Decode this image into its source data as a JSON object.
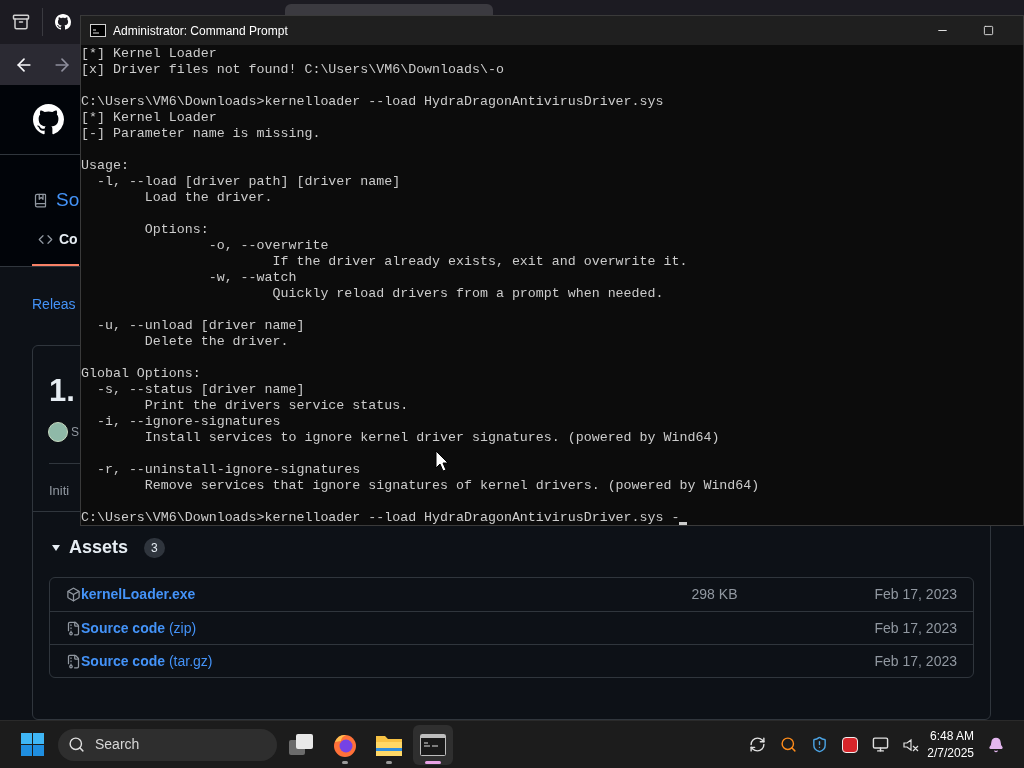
{
  "browser": {
    "repo_name": "So",
    "code_tab": {
      "label": "Co",
      "selected": true
    },
    "releases_link": "Releas",
    "release": {
      "version": "1.",
      "author": "S",
      "note": "Initi",
      "assets": {
        "title": "Assets",
        "count": "3",
        "expanded": true,
        "rows": [
          {
            "kind": "package",
            "name": "kernelLoader.exe",
            "size": "298 KB",
            "date": "Feb 17, 2023"
          },
          {
            "kind": "archive",
            "name": "Source code",
            "suffix": "(zip)",
            "date": "Feb 17, 2023"
          },
          {
            "kind": "archive",
            "name": "Source code",
            "suffix": "(tar.gz)",
            "date": "Feb 17, 2023"
          }
        ]
      }
    }
  },
  "terminal": {
    "title": "Administrator: Command Prompt",
    "blocks": [
      [
        "[*] Kernel Loader",
        "[x] Driver files not found! C:\\Users\\VM6\\Downloads\\-o"
      ],
      [
        "C:\\Users\\VM6\\Downloads>kernelloader --load HydraDragonAntivirusDriver.sys",
        "[*] Kernel Loader",
        "[-] Parameter name is missing."
      ],
      [
        "Usage:",
        "  -l, --load [driver path] [driver name]",
        "        Load the driver."
      ],
      [
        "        Options:",
        "                -o, --overwrite",
        "                        If the driver already exists, exit and overwrite it.",
        "                -w, --watch",
        "                        Quickly reload drivers from a prompt when needed."
      ],
      [
        "  -u, --unload [driver name]",
        "        Delete the driver."
      ],
      [
        "Global Options:",
        "  -s, --status [driver name]",
        "        Print the drivers service status.",
        "  -i, --ignore-signatures",
        "        Install services to ignore kernel driver signatures. (powered by Wind64)"
      ],
      [
        "  -r, --uninstall-ignore-signatures",
        "        Remove services that ignore signatures of kernel drivers. (powered by Wind64)"
      ]
    ],
    "prompt": "C:\\Users\\VM6\\Downloads>kernelloader --load HydraDragonAntivirusDriver.sys -"
  },
  "taskbar": {
    "search_placeholder": "Search",
    "apps": [
      {
        "kind": "task-view",
        "running": false,
        "selected": false
      },
      {
        "kind": "firefox",
        "running": true,
        "selected": false
      },
      {
        "kind": "files",
        "running": true,
        "selected": false
      },
      {
        "kind": "terminal",
        "running": true,
        "selected": true
      }
    ],
    "time": "6:48 AM",
    "date": "2/7/2025"
  }
}
